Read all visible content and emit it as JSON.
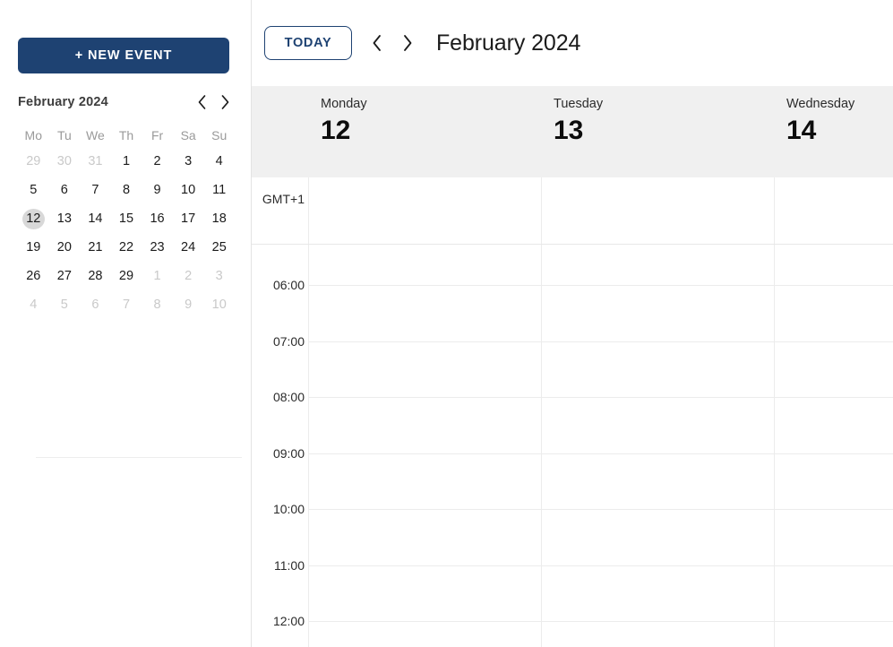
{
  "sidebar": {
    "new_event_label": "+ NEW EVENT",
    "mini_calendar": {
      "title": "February 2024",
      "prev_icon": "chevron-left-icon",
      "next_icon": "chevron-right-icon",
      "weekdays": [
        "Mo",
        "Tu",
        "We",
        "Th",
        "Fr",
        "Sa",
        "Su"
      ],
      "weeks": [
        [
          {
            "n": "29",
            "muted": true,
            "today": false
          },
          {
            "n": "30",
            "muted": true,
            "today": false
          },
          {
            "n": "31",
            "muted": true,
            "today": false
          },
          {
            "n": "1",
            "muted": false,
            "today": false
          },
          {
            "n": "2",
            "muted": false,
            "today": false
          },
          {
            "n": "3",
            "muted": false,
            "today": false
          },
          {
            "n": "4",
            "muted": false,
            "today": false
          }
        ],
        [
          {
            "n": "5",
            "muted": false,
            "today": false
          },
          {
            "n": "6",
            "muted": false,
            "today": false
          },
          {
            "n": "7",
            "muted": false,
            "today": false
          },
          {
            "n": "8",
            "muted": false,
            "today": false
          },
          {
            "n": "9",
            "muted": false,
            "today": false
          },
          {
            "n": "10",
            "muted": false,
            "today": false
          },
          {
            "n": "11",
            "muted": false,
            "today": false
          }
        ],
        [
          {
            "n": "12",
            "muted": false,
            "today": true
          },
          {
            "n": "13",
            "muted": false,
            "today": false
          },
          {
            "n": "14",
            "muted": false,
            "today": false
          },
          {
            "n": "15",
            "muted": false,
            "today": false
          },
          {
            "n": "16",
            "muted": false,
            "today": false
          },
          {
            "n": "17",
            "muted": false,
            "today": false
          },
          {
            "n": "18",
            "muted": false,
            "today": false
          }
        ],
        [
          {
            "n": "19",
            "muted": false,
            "today": false
          },
          {
            "n": "20",
            "muted": false,
            "today": false
          },
          {
            "n": "21",
            "muted": false,
            "today": false
          },
          {
            "n": "22",
            "muted": false,
            "today": false
          },
          {
            "n": "23",
            "muted": false,
            "today": false
          },
          {
            "n": "24",
            "muted": false,
            "today": false
          },
          {
            "n": "25",
            "muted": false,
            "today": false
          }
        ],
        [
          {
            "n": "26",
            "muted": false,
            "today": false
          },
          {
            "n": "27",
            "muted": false,
            "today": false
          },
          {
            "n": "28",
            "muted": false,
            "today": false
          },
          {
            "n": "29",
            "muted": false,
            "today": false
          },
          {
            "n": "1",
            "muted": true,
            "today": false
          },
          {
            "n": "2",
            "muted": true,
            "today": false
          },
          {
            "n": "3",
            "muted": true,
            "today": false
          }
        ],
        [
          {
            "n": "4",
            "muted": true,
            "today": false
          },
          {
            "n": "5",
            "muted": true,
            "today": false
          },
          {
            "n": "6",
            "muted": true,
            "today": false
          },
          {
            "n": "7",
            "muted": true,
            "today": false
          },
          {
            "n": "8",
            "muted": true,
            "today": false
          },
          {
            "n": "9",
            "muted": true,
            "today": false
          },
          {
            "n": "10",
            "muted": true,
            "today": false
          }
        ]
      ]
    }
  },
  "toolbar": {
    "today_label": "TODAY",
    "prev_icon": "chevron-left-icon",
    "next_icon": "chevron-right-icon",
    "range_title": "February 2024"
  },
  "calendar": {
    "timezone_label": "GMT+1",
    "days": [
      {
        "name": "Monday",
        "num": "12"
      },
      {
        "name": "Tuesday",
        "num": "13"
      },
      {
        "name": "Wednesday",
        "num": "14"
      }
    ],
    "hours": [
      "06:00",
      "07:00",
      "08:00",
      "09:00",
      "10:00",
      "11:00",
      "12:00"
    ]
  },
  "colors": {
    "accent": "#1e4272",
    "header_band": "#f0f0f0",
    "gridline": "#ececec",
    "muted_text": "#9a9a9a",
    "today_chip": "#d8d8d8"
  }
}
